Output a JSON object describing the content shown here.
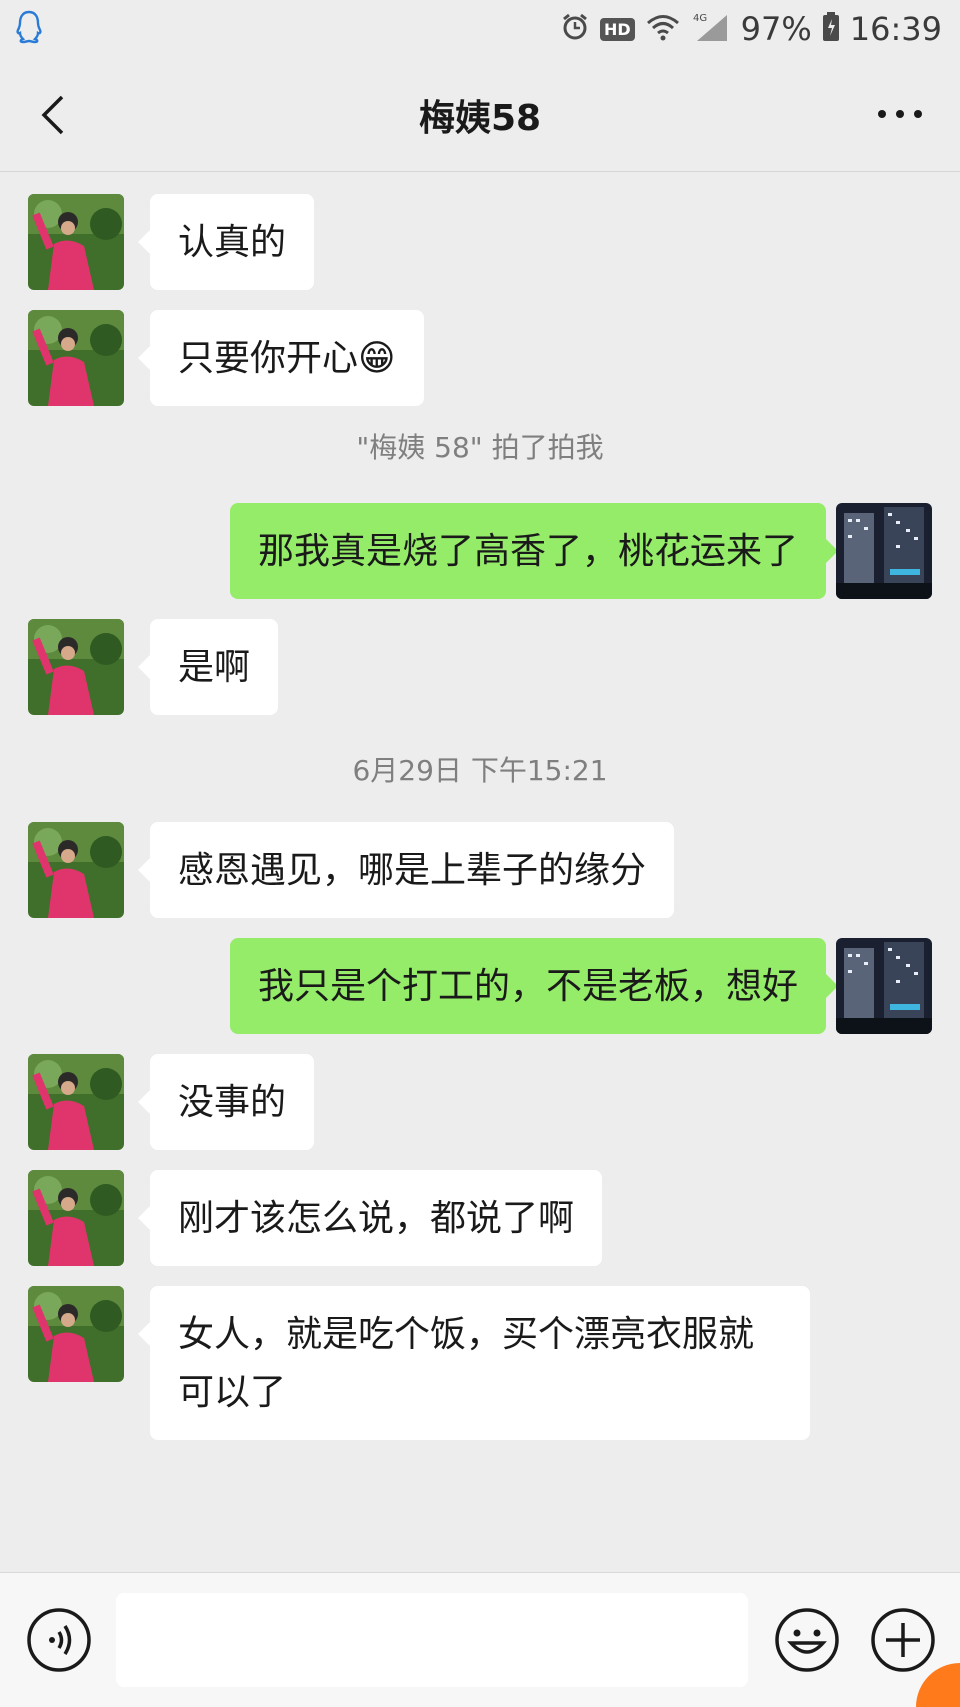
{
  "status": {
    "battery": "97%",
    "time": "16:39",
    "hd": "HD",
    "network": "4G"
  },
  "header": {
    "title": "梅姨58"
  },
  "messages": [
    {
      "side": "in",
      "text": "认真的"
    },
    {
      "side": "in",
      "text": "只要你开心",
      "emoji": "😁"
    },
    {
      "side": "system",
      "text": "\"梅姨 58\" 拍了拍我"
    },
    {
      "side": "out",
      "text": "那我真是烧了高香了，桃花运来了"
    },
    {
      "side": "in",
      "text": "是啊"
    },
    {
      "side": "system",
      "text": "6月29日 下午15:21"
    },
    {
      "side": "in",
      "text": "感恩遇见，哪是上辈子的缘分"
    },
    {
      "side": "out",
      "text": "我只是个打工的，不是老板，想好"
    },
    {
      "side": "in",
      "text": "没事的"
    },
    {
      "side": "in",
      "text": "刚才该怎么说，都说了啊"
    },
    {
      "side": "in",
      "text": "女人，就是吃个饭，买个漂亮衣服就可以了"
    }
  ],
  "input": {
    "placeholder": ""
  },
  "colors": {
    "out_bubble": "#95ec69",
    "in_bubble": "#ffffff",
    "background": "#ededed"
  }
}
